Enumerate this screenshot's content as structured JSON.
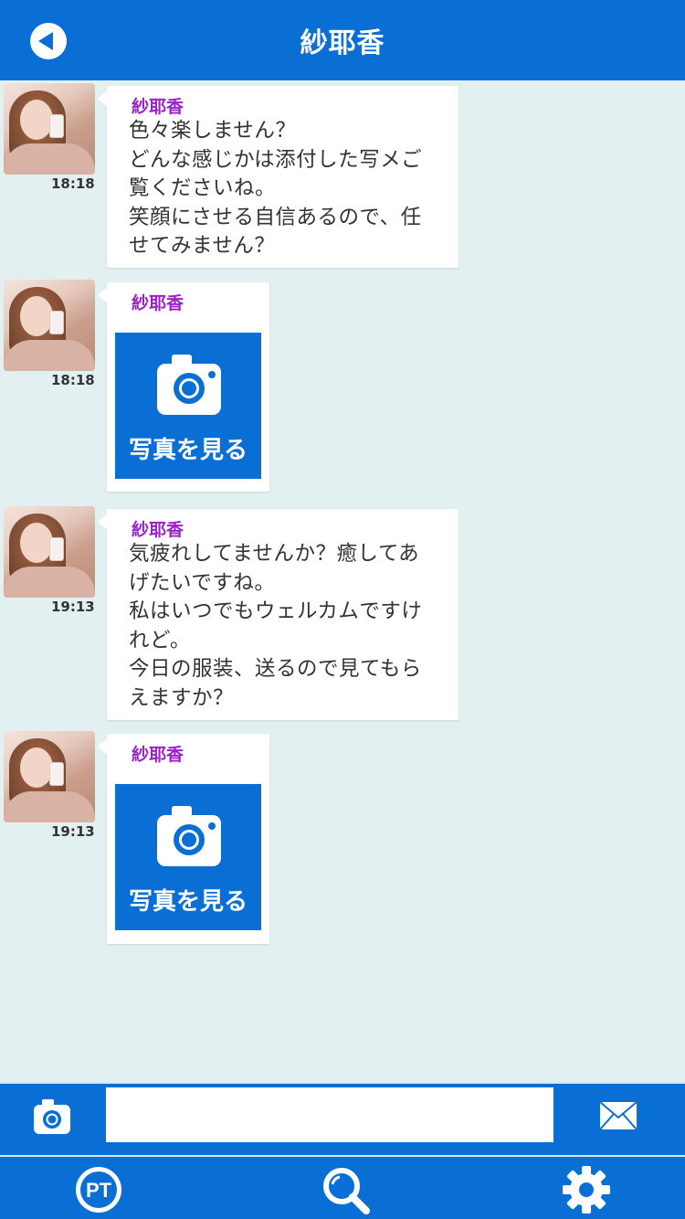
{
  "header": {
    "title": "紗耶香",
    "back_icon": "back-arrow-icon"
  },
  "messages": [
    {
      "sender": "紗耶香",
      "time": "18:18",
      "type": "text",
      "lines": [
        "色々楽しません？",
        "どんな感じかは添付した写メご",
        "覧くださいね。",
        "笑顔にさせる自信あるので、任",
        "せてみません？"
      ]
    },
    {
      "sender": "紗耶香",
      "time": "18:18",
      "type": "photo",
      "photo_label": "写真を見る"
    },
    {
      "sender": "紗耶香",
      "time": "19:13",
      "type": "text",
      "lines": [
        "気疲れしてませんか？癒してあ",
        "げたいですね。",
        "私はいつでもウェルカムですけ",
        "れど。",
        "今日の服装、送るので見てもら",
        "えますか？"
      ]
    },
    {
      "sender": "紗耶香",
      "time": "19:13",
      "type": "photo",
      "photo_label": "写真を見る"
    }
  ],
  "input_bar": {
    "camera_icon": "camera-icon",
    "input_value": "",
    "send_icon": "envelope-icon"
  },
  "bottom_nav": {
    "items": [
      {
        "icon": "pt-points-icon",
        "label": "PT"
      },
      {
        "icon": "search-icon"
      },
      {
        "icon": "gear-icon"
      }
    ]
  },
  "colors": {
    "primary": "#0a6fd5",
    "background": "#e3f0f1",
    "sender": "#9b22c6",
    "text": "#333333"
  }
}
